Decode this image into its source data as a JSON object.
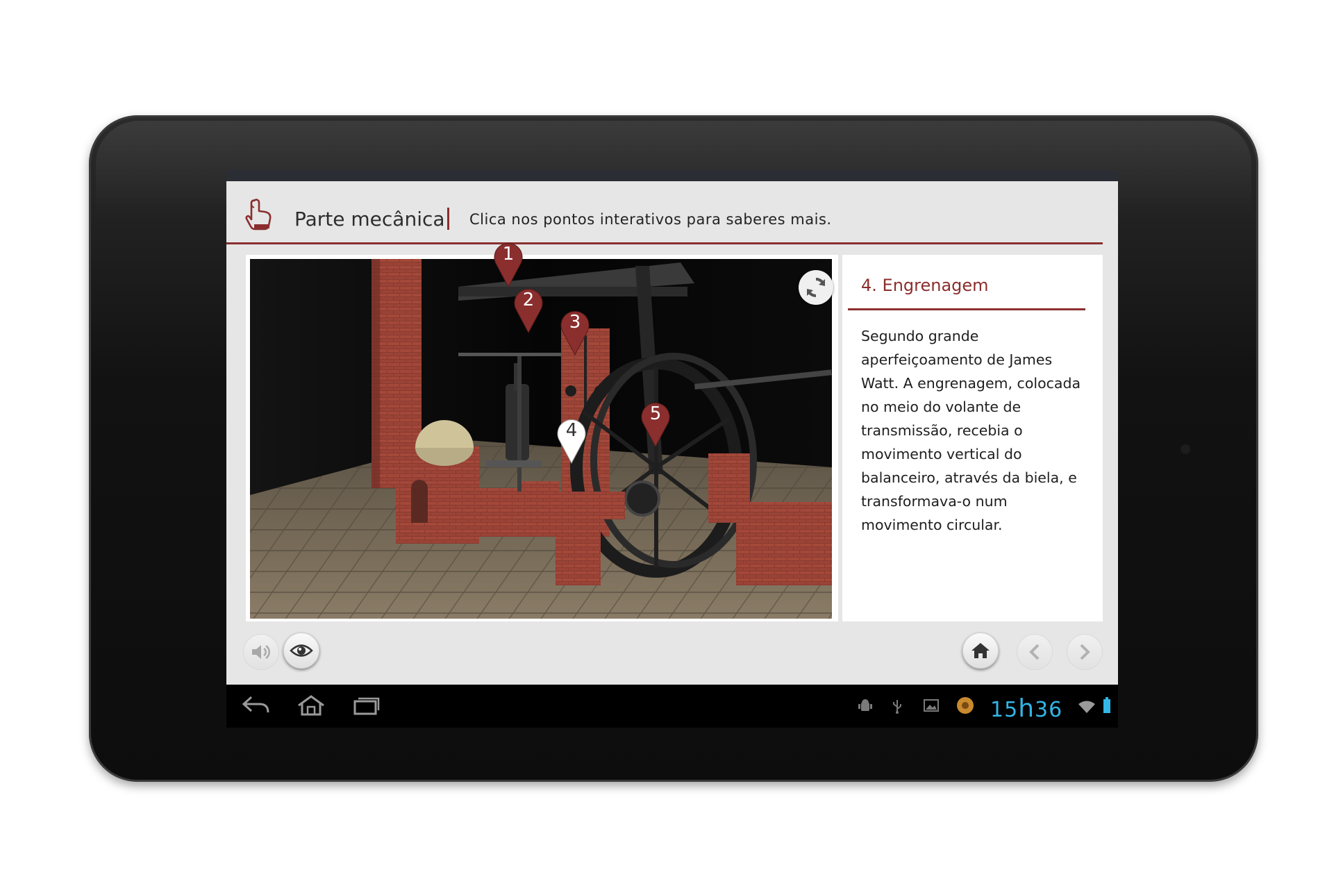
{
  "header": {
    "title": "Parte mecânica",
    "separator": "|",
    "subtitle": "Clica nos pontos interativos para saberes mais."
  },
  "hotspots": [
    {
      "label": "1",
      "active": false
    },
    {
      "label": "2",
      "active": false
    },
    {
      "label": "3",
      "active": false
    },
    {
      "label": "4",
      "active": true
    },
    {
      "label": "5",
      "active": false
    }
  ],
  "info_panel": {
    "title": "4. Engrenagem",
    "text": "Segundo grande aperfeiçoamento de James Watt. A engrenagem, colocada no meio do volante de transmissão, recebia o movimento vertical do balanceiro, através da biela, e transformava-o num movimento circular."
  },
  "controls": {
    "left": [
      "sound-icon",
      "eye-icon"
    ],
    "right": [
      "home-icon",
      "chevron-left-icon",
      "chevron-right-icon"
    ]
  },
  "system_bar": {
    "clock_hours": "15",
    "clock_sep": "h",
    "clock_minutes": "36"
  },
  "colors": {
    "accent": "#8a2e2e",
    "clock": "#33b5e5",
    "app_background": "#e6e6e6"
  }
}
